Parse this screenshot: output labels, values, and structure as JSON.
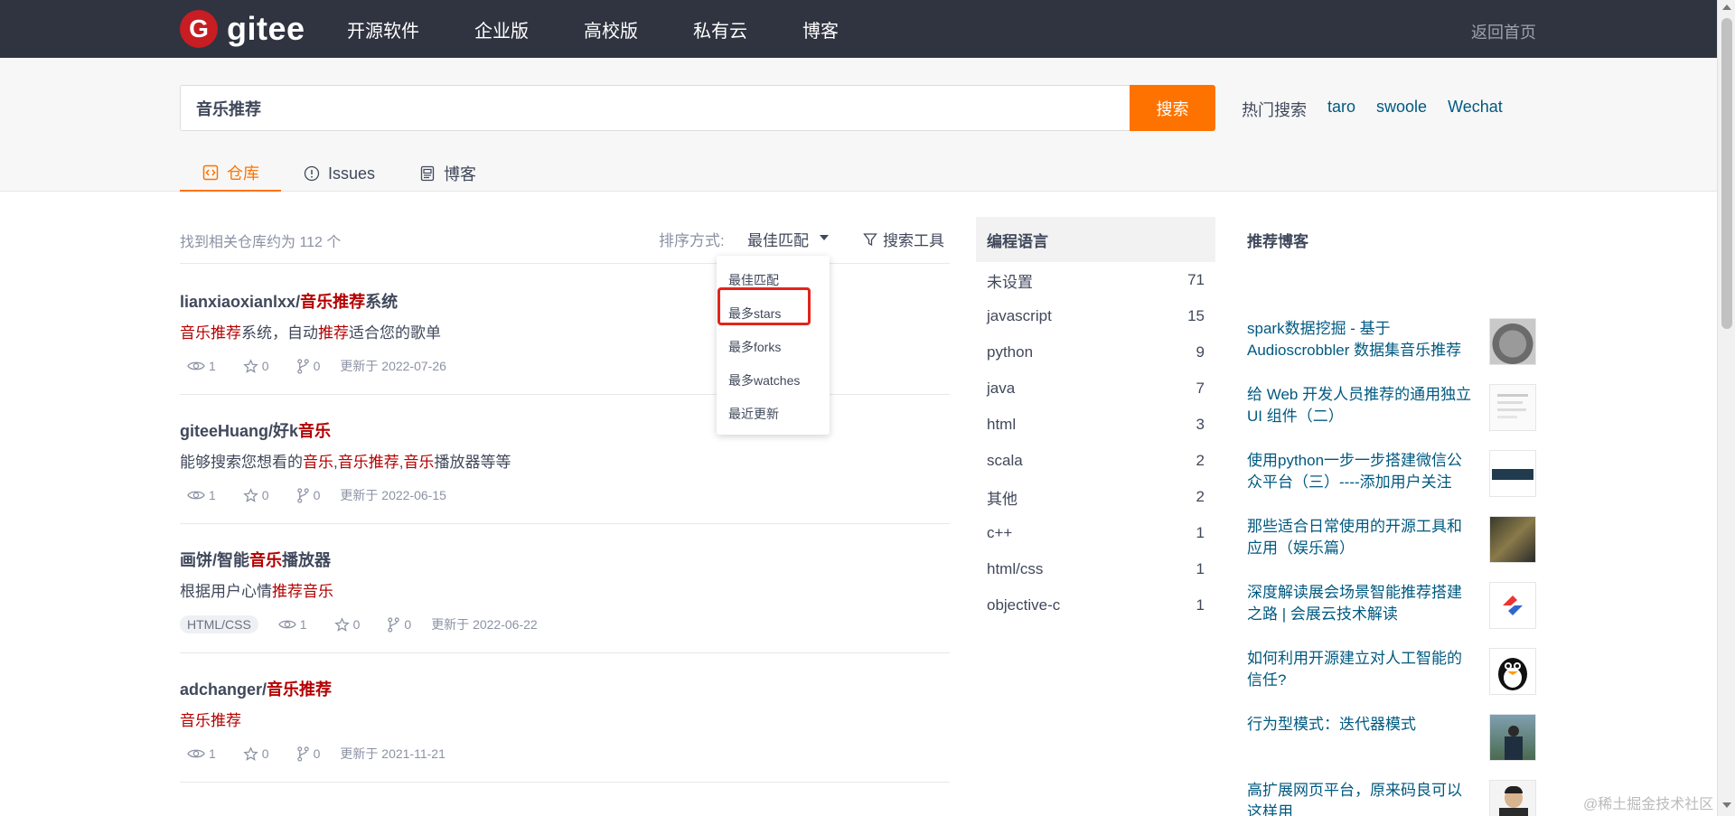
{
  "header": {
    "logo_glyph": "G",
    "logo_text": "gitee",
    "nav": [
      "开源软件",
      "企业版",
      "高校版",
      "私有云",
      "博客"
    ],
    "back_home": "返回首页"
  },
  "search": {
    "query": "音乐推荐",
    "button": "搜索",
    "hot_label": "热门搜索",
    "hot_terms": [
      "taro",
      "swoole",
      "Wechat"
    ]
  },
  "tabs": [
    {
      "label": "仓库",
      "icon": "code-icon",
      "active": true
    },
    {
      "label": "Issues",
      "icon": "issue-icon",
      "active": false
    },
    {
      "label": "博客",
      "icon": "blog-icon",
      "active": false
    }
  ],
  "results": {
    "count_text": "找到相关仓库约为 112 个",
    "sort_label": "排序方式:",
    "sort_value": "最佳匹配",
    "tools_label": "搜索工具",
    "sort_options": [
      "最佳匹配",
      "最多stars",
      "最多forks",
      "最多watches",
      "最近更新"
    ],
    "highlighted_option": "最多stars",
    "repos": [
      {
        "title_parts": [
          {
            "t": "lianxiaoxianlxx/",
            "h": false
          },
          {
            "t": "音乐推荐",
            "h": true
          },
          {
            "t": "系统",
            "h": false
          }
        ],
        "desc_parts": [
          {
            "t": "音乐推荐",
            "h": true
          },
          {
            "t": "系统，自动",
            "h": false
          },
          {
            "t": "推荐",
            "h": true
          },
          {
            "t": "适合您的歌单",
            "h": false
          }
        ],
        "lang": "",
        "watches": "1",
        "stars": "0",
        "forks": "0",
        "updated": "更新于 2022-07-26"
      },
      {
        "title_parts": [
          {
            "t": "giteeHuang/好k",
            "h": false
          },
          {
            "t": "音乐",
            "h": true
          }
        ],
        "desc_parts": [
          {
            "t": "能够搜索您想看的",
            "h": false
          },
          {
            "t": "音乐",
            "h": true
          },
          {
            "t": ",",
            "h": false
          },
          {
            "t": "音乐推荐",
            "h": true
          },
          {
            "t": ",",
            "h": false
          },
          {
            "t": "音乐",
            "h": true
          },
          {
            "t": "播放器等等",
            "h": false
          }
        ],
        "lang": "",
        "watches": "1",
        "stars": "0",
        "forks": "0",
        "updated": "更新于 2022-06-15"
      },
      {
        "title_parts": [
          {
            "t": "画饼/智能",
            "h": false
          },
          {
            "t": "音乐",
            "h": true
          },
          {
            "t": "播放器",
            "h": false
          }
        ],
        "desc_parts": [
          {
            "t": "根据用户心情",
            "h": false
          },
          {
            "t": "推荐音乐",
            "h": true
          }
        ],
        "lang": "HTML/CSS",
        "watches": "1",
        "stars": "0",
        "forks": "0",
        "updated": "更新于 2022-06-22"
      },
      {
        "title_parts": [
          {
            "t": "adchanger/",
            "h": false
          },
          {
            "t": "音乐推荐",
            "h": true
          }
        ],
        "desc_parts": [
          {
            "t": "音乐推荐",
            "h": true
          }
        ],
        "lang": "",
        "watches": "1",
        "stars": "0",
        "forks": "0",
        "updated": "更新于 2021-11-21"
      }
    ]
  },
  "languages": {
    "title": "编程语言",
    "items": [
      {
        "name": "未设置",
        "count": "71"
      },
      {
        "name": "javascript",
        "count": "15"
      },
      {
        "name": "python",
        "count": "9"
      },
      {
        "name": "java",
        "count": "7"
      },
      {
        "name": "html",
        "count": "3"
      },
      {
        "name": "scala",
        "count": "2"
      },
      {
        "name": "其他",
        "count": "2"
      },
      {
        "name": "c++",
        "count": "1"
      },
      {
        "name": "html/css",
        "count": "1"
      },
      {
        "name": "objective-c",
        "count": "1"
      }
    ]
  },
  "blogs": {
    "title": "推荐博客",
    "items": [
      {
        "text": "spark数据挖掘 - 基于 Audioscrobbler 数据集音乐推荐",
        "thumb": "koala"
      },
      {
        "text": "给 Web 开发人员推荐的通用独立 UI 组件（二）",
        "thumb": "document"
      },
      {
        "text": "使用python一步一步搭建微信公众平台（三）----添加用户关注",
        "thumb": "dark-banner"
      },
      {
        "text": "那些适合日常使用的开源工具和应用（娱乐篇）",
        "thumb": "photo"
      },
      {
        "text": "深度解读展会场景智能推荐搭建之路 | 会展云技术解读",
        "thumb": "logo"
      },
      {
        "text": "如何利用开源建立对人工智能的信任?",
        "thumb": "penguin"
      },
      {
        "text": "行为型模式：迭代器模式",
        "thumb": "person-outdoor"
      },
      {
        "text": "高扩展网页平台，原来码良可以这样用",
        "thumb": "person-portrait"
      }
    ]
  },
  "watermark": "@稀土掘金技术社区",
  "colors": {
    "header_bg": "#2f3440",
    "accent": "#fe7300",
    "highlight": "#b40000",
    "link": "#005980",
    "callout": "#e3241b"
  }
}
